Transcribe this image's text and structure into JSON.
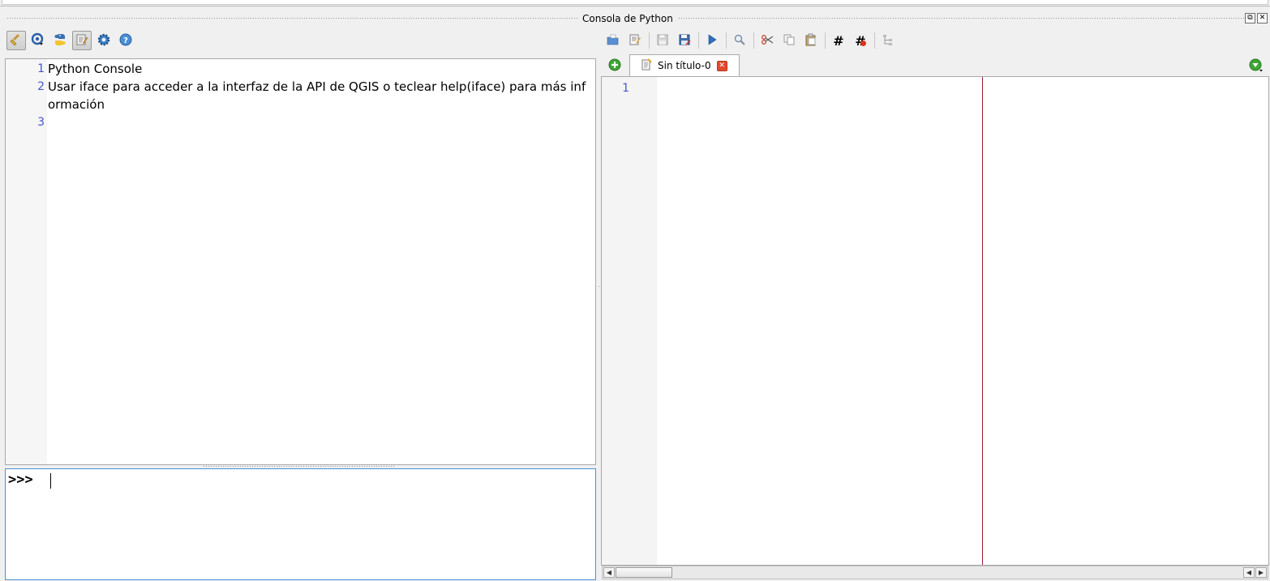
{
  "window": {
    "title": "Consola de Python",
    "float_label": "⧉",
    "close_label": "✕"
  },
  "console_toolbar": {
    "items": [
      {
        "icon": "clear-console-icon"
      },
      {
        "icon": "import-class-icon"
      },
      {
        "icon": "run-command-icon"
      },
      {
        "icon": "show-editor-icon",
        "active": true
      },
      {
        "icon": "settings-gear-icon"
      },
      {
        "icon": "help-icon"
      }
    ]
  },
  "editor_toolbar": {
    "items": [
      {
        "icon": "open-file-icon"
      },
      {
        "icon": "open-in-external-editor-icon"
      },
      {
        "icon": "save-icon"
      },
      {
        "icon": "save-as-icon"
      },
      {
        "icon": "run-script-icon"
      },
      {
        "icon": "find-icon"
      },
      {
        "icon": "cut-icon"
      },
      {
        "icon": "copy-icon"
      },
      {
        "icon": "paste-icon"
      },
      {
        "icon": "comment-icon",
        "glyph": "#"
      },
      {
        "icon": "uncomment-icon",
        "glyph": "#"
      },
      {
        "icon": "object-inspector-icon"
      }
    ]
  },
  "console_output": {
    "lines": [
      {
        "number": "1",
        "text": "Python Console"
      },
      {
        "number": "2",
        "text": "Usar iface para acceder a la interfaz de la API de QGIS o teclear help(iface) para más inf"
      },
      {
        "number": "",
        "text": "ormación"
      },
      {
        "number": "3",
        "text": ""
      }
    ]
  },
  "console_input": {
    "prompt": ">>>"
  },
  "editor": {
    "tabs": [
      {
        "label": "Sin título-0",
        "close": "✕"
      }
    ],
    "line_numbers": [
      "1"
    ]
  },
  "colors": {
    "line_number": "#4a55c8",
    "edge_line": "#9a1a2a",
    "input_focus": "#4a90d9",
    "add_tab": "#3fa535",
    "tab_close": "#e04a2a"
  }
}
